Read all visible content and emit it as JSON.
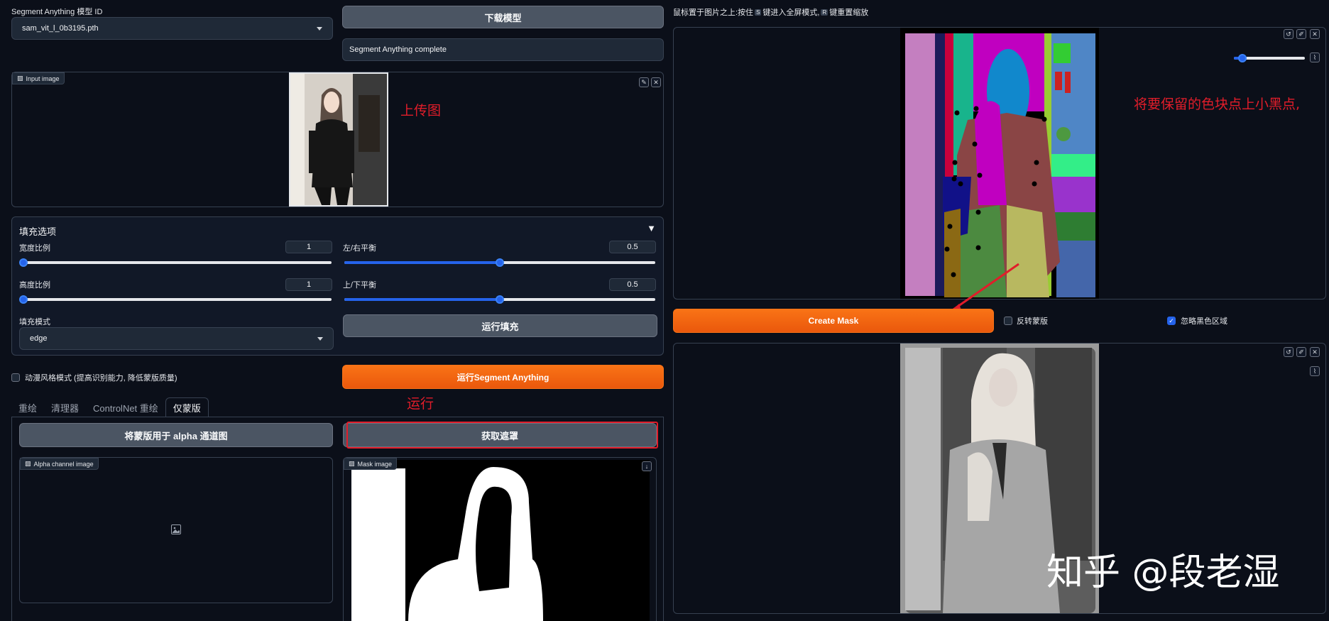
{
  "left": {
    "model_label": "Segment Anything 模型 ID",
    "model_value": "sam_vit_l_0b3195.pth",
    "download_button": "下载模型",
    "status_text": "Segment Anything complete",
    "input_image_label": "Input image",
    "fill_options": {
      "title": "填充选项",
      "width_ratio_label": "宽度比例",
      "width_ratio_value": "1",
      "lr_balance_label": "左/右平衡",
      "lr_balance_value": "0.5",
      "height_ratio_label": "高度比例",
      "height_ratio_value": "1",
      "tb_balance_label": "上/下平衡",
      "tb_balance_value": "0.5",
      "fill_mode_label": "填充模式",
      "fill_mode_value": "edge",
      "run_fill_button": "运行填充"
    },
    "anime_mode_label": "动漫风格模式 (提高识别能力, 降低蒙版质量)",
    "run_sam_button": "运行Segment Anything",
    "tabs": [
      "重绘",
      "清理器",
      "ControlNet 重绘",
      "仅蒙版"
    ],
    "alpha_button": "将蒙版用于 alpha 通道图",
    "get_mask_button": "获取遮罩",
    "alpha_image_label": "Alpha channel image",
    "mask_image_label": "Mask image"
  },
  "right": {
    "hint_text_1": "鼠标置于图片之上:按住",
    "hint_key_1": "S",
    "hint_text_2": "键进入全屏模式,",
    "hint_key_2": "R",
    "hint_text_3": "键重置缩放",
    "create_mask_button": "Create Mask",
    "invert_mask_label": "反转蒙版",
    "ignore_black_label": "忽略黑色区域"
  },
  "annotations": {
    "upload": "上传图",
    "run": "运行",
    "dots": "将要保留的色块点上小黑点,"
  },
  "watermark": "知乎 @段老湿",
  "colors": {
    "accent_orange": "#f97316",
    "slider_blue": "#2563eb",
    "annotation_red": "#e11d2a"
  }
}
